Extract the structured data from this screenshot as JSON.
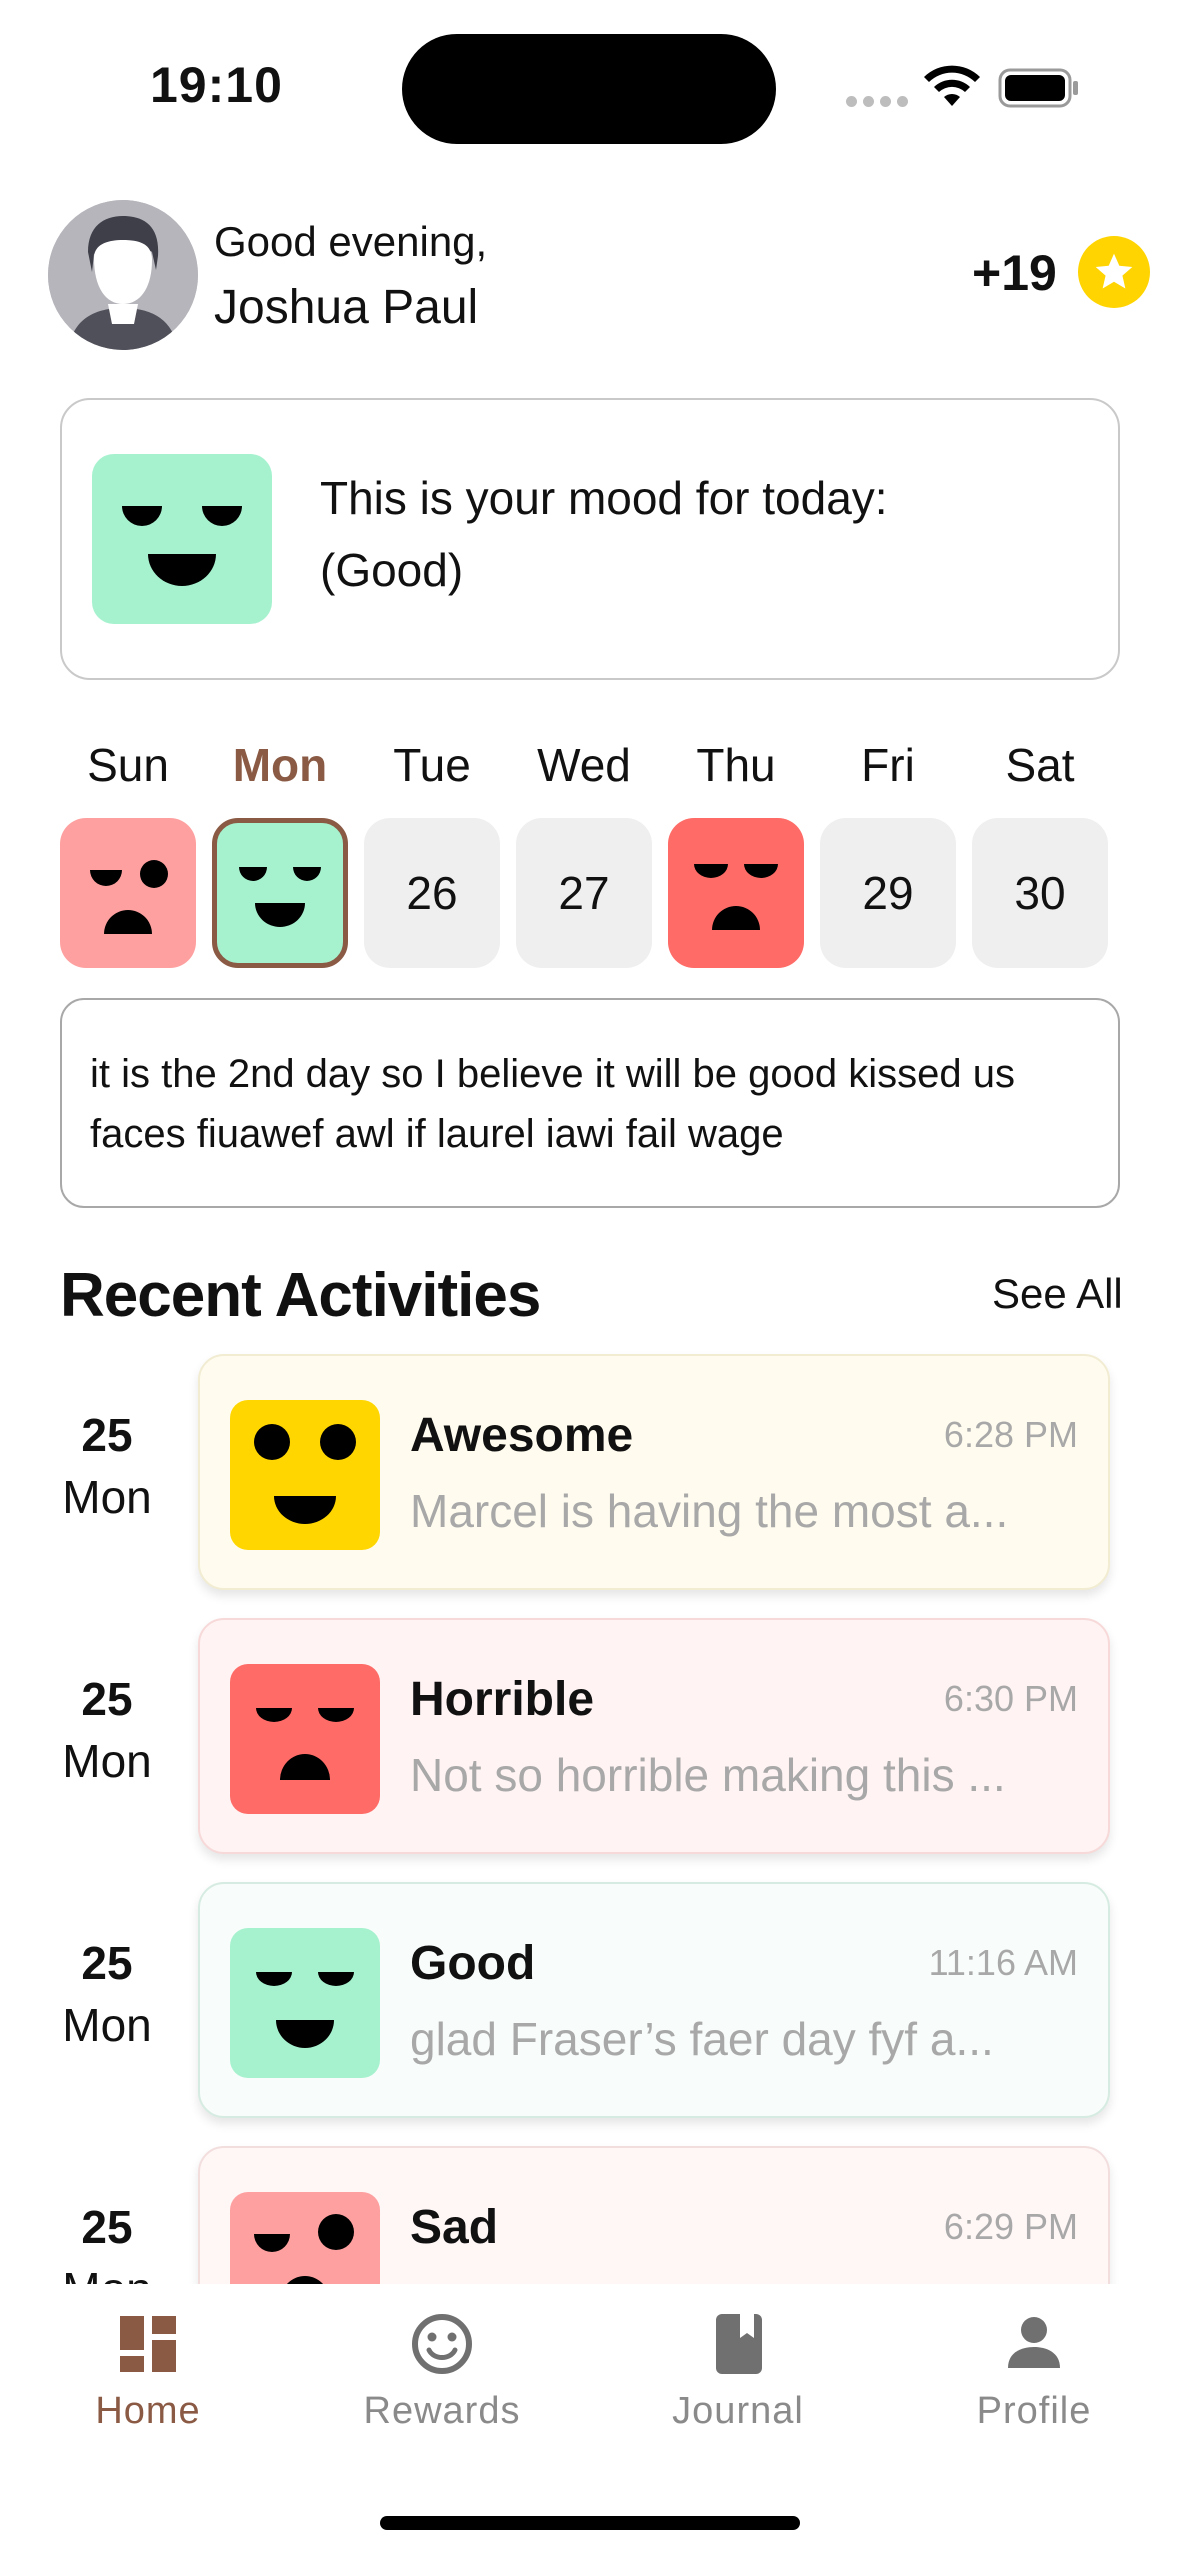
{
  "status_bar": {
    "time": "19:10"
  },
  "header": {
    "greeting": "Good evening,",
    "name": "Joshua Paul",
    "points": "+19"
  },
  "mood_today": {
    "line1": "This is your mood for today:",
    "line2": "(Good)",
    "mood": "good"
  },
  "week": {
    "days": [
      {
        "label": "Sun",
        "value": "",
        "mood": "sad"
      },
      {
        "label": "Mon",
        "value": "",
        "mood": "good",
        "selected": true
      },
      {
        "label": "Tue",
        "value": "26"
      },
      {
        "label": "Wed",
        "value": "27"
      },
      {
        "label": "Thu",
        "value": "",
        "mood": "horrible"
      },
      {
        "label": "Fri",
        "value": "29"
      },
      {
        "label": "Sat",
        "value": "30"
      }
    ]
  },
  "note": {
    "text": "it is the 2nd day so I believe it will be good kissed us faces fiuawef awl if laurel iawi fail wage"
  },
  "recent": {
    "title": "Recent Activities",
    "see_all": "See All",
    "items": [
      {
        "day": "25",
        "dow": "Mon",
        "mood": "Awesome",
        "time": "6:28 PM",
        "desc": "Marcel is having the most a...",
        "color": "#ffd600",
        "bg": "#fffcef",
        "border": "#f1ecd2"
      },
      {
        "day": "25",
        "dow": "Mon",
        "mood": "Horrible",
        "time": "6:30 PM",
        "desc": "Not so horrible making this ...",
        "color": "#ff6b66",
        "bg": "#fff3f3",
        "border": "#f7d9d9"
      },
      {
        "day": "25",
        "dow": "Mon",
        "mood": "Good",
        "time": "11:16 AM",
        "desc": "glad Fraser’s faer day fyf a...",
        "color": "#a6f2cf",
        "bg": "#f8fcfa",
        "border": "#d6ece2"
      },
      {
        "day": "25",
        "dow": "Mon",
        "mood": "Sad",
        "time": "6:29 PM",
        "desc": "",
        "color": "#ffa0a0",
        "bg": "#fff6f6",
        "border": "#f3dede"
      }
    ]
  },
  "tabs": [
    {
      "label": "Home",
      "icon": "dashboard-icon",
      "active": true
    },
    {
      "label": "Rewards",
      "icon": "smiley-icon"
    },
    {
      "label": "Journal",
      "icon": "book-icon"
    },
    {
      "label": "Profile",
      "icon": "person-icon"
    }
  ],
  "colors": {
    "accent": "#8a5a44",
    "good": "#a6f2cf",
    "awesome": "#ffd600",
    "horrible": "#ff6b66",
    "sad": "#ffa0a0",
    "star": "#ffd400"
  }
}
